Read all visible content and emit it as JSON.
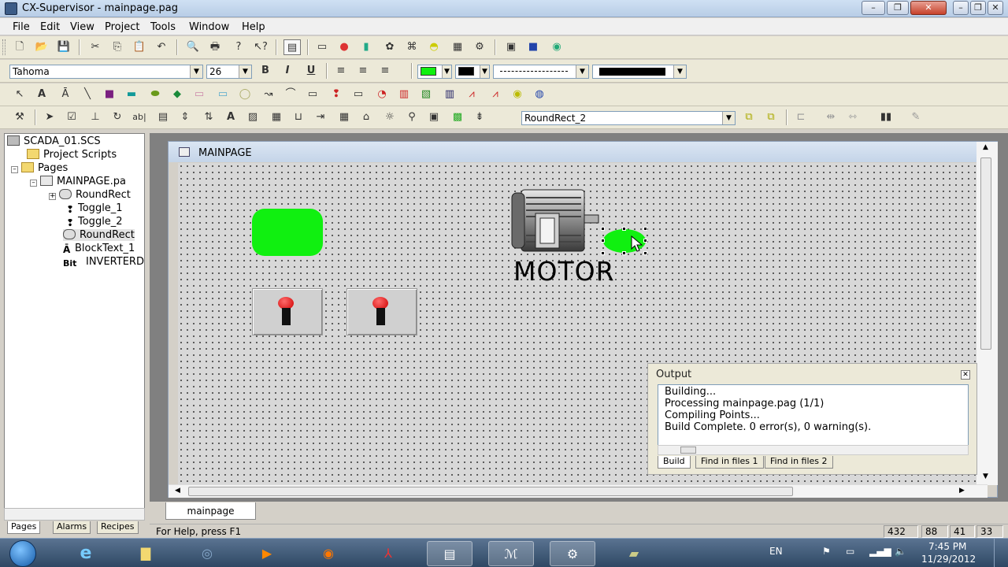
{
  "window": {
    "title": "CX-Supervisor - mainpage.pag"
  },
  "menu": [
    "File",
    "Edit",
    "View",
    "Project",
    "Tools",
    "Window",
    "Help"
  ],
  "format_bar": {
    "font_name": "Tahoma",
    "font_size": "26",
    "bold": "B",
    "italic": "I",
    "underline": "U"
  },
  "object_combo": "RoundRect_2",
  "tree": {
    "root": "SCADA_01.SCS",
    "project_scripts": "Project Scripts",
    "pages": "Pages",
    "mainpage": "MAINPAGE.pa",
    "items": [
      "RoundRect",
      "Toggle_1",
      "Toggle_2",
      "RoundRect",
      "BlockText_1",
      "INVERTERD"
    ]
  },
  "left_tabs": [
    "Pages",
    "Alarms",
    "Recipes"
  ],
  "page": {
    "title": "MAINPAGE",
    "motor_label": "MOTOR"
  },
  "output": {
    "title": "Output",
    "lines": [
      "Building...",
      "Processing  mainpage.pag (1/1)",
      "Compiling Points...",
      "Build Complete. 0 error(s), 0 warning(s)."
    ],
    "tabs": [
      "Build",
      "Find in files 1",
      "Find in files 2"
    ]
  },
  "page_tab": "mainpage",
  "status": {
    "help": "For Help, press F1",
    "cells": [
      "432",
      "88",
      "41",
      "33"
    ]
  },
  "taskbar": {
    "lang": "EN",
    "time": "7:45 PM",
    "date": "11/29/2012"
  },
  "colors": {
    "object_green": "#10f010",
    "toggle_red": "#d00000"
  }
}
